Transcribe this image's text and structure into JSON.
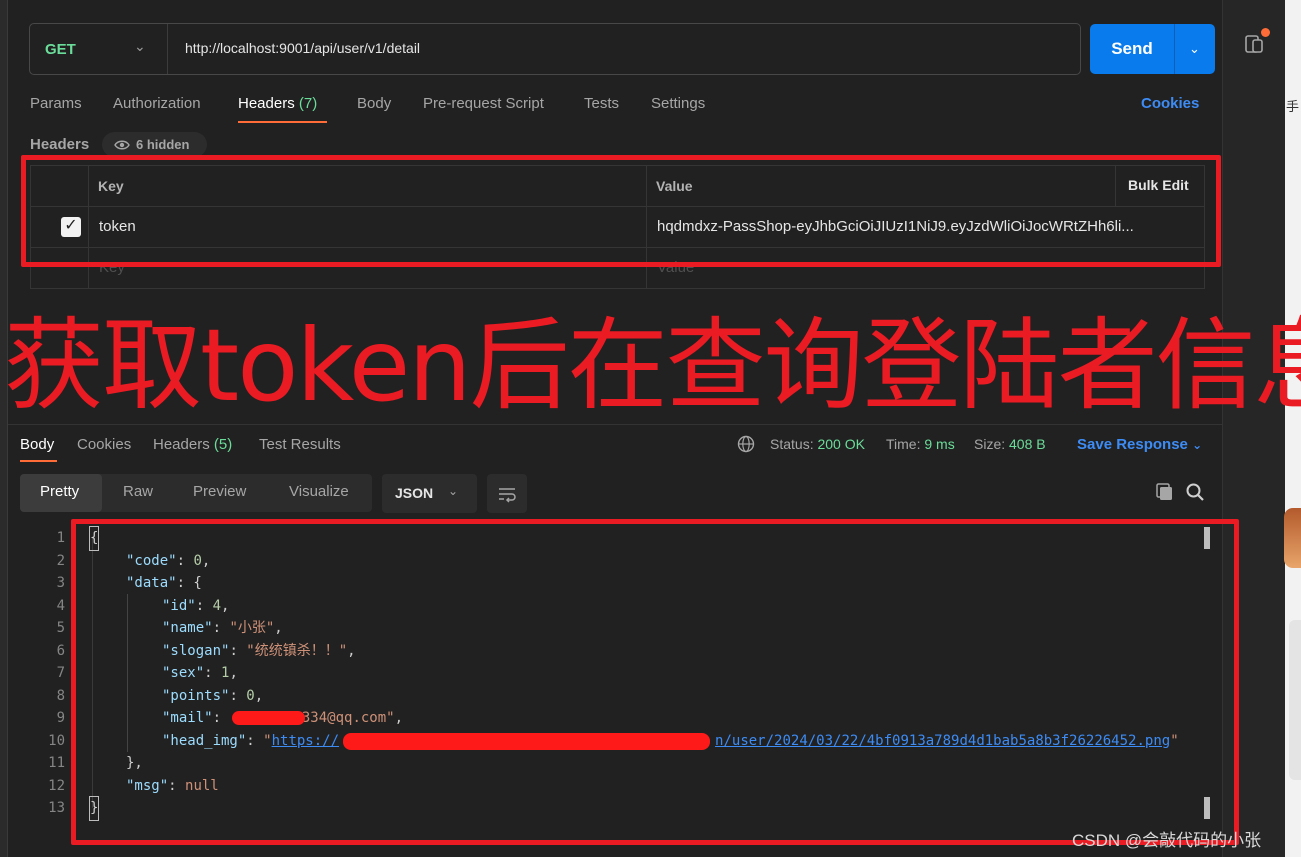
{
  "request": {
    "method": "GET",
    "url": "http://localhost:9001/api/user/v1/detail",
    "send_label": "Send"
  },
  "request_tabs": {
    "params": "Params",
    "authorization": "Authorization",
    "headers": "Headers",
    "headers_count": "(7)",
    "body": "Body",
    "prerequest": "Pre-request Script",
    "tests": "Tests",
    "settings": "Settings",
    "cookies": "Cookies"
  },
  "headers_section": {
    "title": "Headers",
    "hidden_label": "6 hidden",
    "col_key": "Key",
    "col_value": "Value",
    "bulk_edit": "Bulk Edit",
    "row_key": "token",
    "row_value": "hqdmdxz-PassShop-eyJhbGciOiJIUzI1NiJ9.eyJzdWliOiJocWRtZHh6li...",
    "placeholder_key": "Key",
    "placeholder_value": "Value"
  },
  "annotation": "获取token后在查询登陆者信息",
  "response_tabs": {
    "body": "Body",
    "cookies": "Cookies",
    "headers": "Headers",
    "headers_count": "(5)",
    "test_results": "Test Results"
  },
  "response_meta": {
    "status_label": "Status:",
    "status_value": "200 OK",
    "time_label": "Time:",
    "time_value": "9 ms",
    "size_label": "Size:",
    "size_value": "408 B",
    "save_response": "Save Response"
  },
  "view_modes": {
    "pretty": "Pretty",
    "raw": "Raw",
    "preview": "Preview",
    "visualize": "Visualize",
    "format": "JSON"
  },
  "code": {
    "line_numbers": [
      "1",
      "2",
      "3",
      "4",
      "5",
      "6",
      "7",
      "8",
      "9",
      "10",
      "11",
      "12",
      "13"
    ],
    "open_brace": "{",
    "code_key": "\"code\"",
    "code_val": "0",
    "data_key": "\"data\"",
    "id_key": "\"id\"",
    "id_val": "4",
    "name_key": "\"name\"",
    "name_val": "\"小张\"",
    "slogan_key": "\"slogan\"",
    "slogan_val": "\"统统镇杀！！\"",
    "sex_key": "\"sex\"",
    "sex_val": "1",
    "points_key": "\"points\"",
    "points_val": "0",
    "mail_key": "\"mail\"",
    "mail_val_tail": "2334@qq.com\"",
    "head_img_key": "\"head_img\"",
    "head_img_start": "https://",
    "head_img_tail": "n/user/2024/03/22/4bf0913a789d4d1bab5a8b3f26226452.png",
    "close_data": "},",
    "msg_key": "\"msg\"",
    "msg_val": "null",
    "close_brace": "}"
  },
  "watermark": "CSDN @会敲代码的小张",
  "side_strip_char": "手",
  "colors": {
    "accent_orange": "#ff6c37",
    "send_blue": "#097bed",
    "link_blue": "#3d8cf5",
    "status_green": "#6bdd9a",
    "annotation_red": "#ea1b23"
  }
}
